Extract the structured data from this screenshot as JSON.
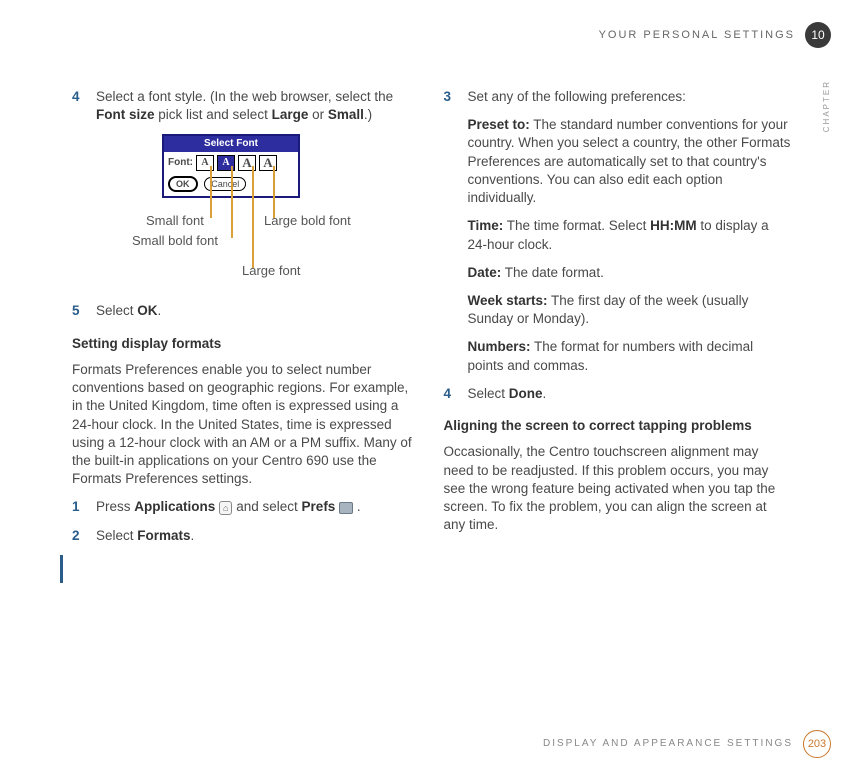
{
  "header": {
    "title": "YOUR PERSONAL SETTINGS",
    "chapter_num": "10"
  },
  "chapter_side": "CHAPTER",
  "footer": {
    "title": "DISPLAY AND APPEARANCE SETTINGS",
    "page_num": "203"
  },
  "left": {
    "step4": {
      "num": "4",
      "pre": "Select a font style. (In the web browser, select the ",
      "b1": "Font size",
      "mid": " pick list and select ",
      "b2": "Large",
      "or": " or ",
      "b3": "Small",
      "end": ".)"
    },
    "figure": {
      "title": "Select Font",
      "label": "Font:",
      "glyph": "A",
      "ok": "OK",
      "cancel": "Cancel",
      "callouts": {
        "small": "Small font",
        "smallbold": "Small bold font",
        "large": "Large font",
        "largebold": "Large bold font"
      }
    },
    "step5": {
      "num": "5",
      "pre": "Select ",
      "b": "OK",
      "end": "."
    },
    "subhead1": "Setting display formats",
    "para1": "Formats Preferences enable you to select number conventions based on geographic regions. For example, in the United Kingdom, time often is expressed using a 24-hour clock. In the United States, time is expressed using a 12-hour clock with an AM or a PM suffix. Many of the built-in applications on your Centro 690 use the Formats Preferences settings.",
    "step1": {
      "num": "1",
      "pre": "Press ",
      "b1": "Applications",
      "mid": " and select ",
      "b2": "Prefs",
      "end": " ."
    },
    "step2": {
      "num": "2",
      "pre": "Select ",
      "b": "Formats",
      "end": "."
    }
  },
  "right": {
    "step3": {
      "num": "3",
      "text": "Set any of the following preferences:"
    },
    "prefs": {
      "preset": {
        "label": "Preset to:",
        "text": " The standard number conventions for your country. When you select a country, the other Formats Preferences are automatically set to that country's conventions. You can also edit each option individually."
      },
      "time": {
        "label": "Time:",
        "pre": " The time format. Select ",
        "b": "HH:MM",
        "post": " to display a 24-hour clock."
      },
      "date": {
        "label": "Date:",
        "text": " The date format."
      },
      "week": {
        "label": "Week starts:",
        "text": " The first day of the week (usually Sunday or Monday)."
      },
      "numbers": {
        "label": "Numbers:",
        "text": " The format for numbers with decimal points and commas."
      }
    },
    "step4": {
      "num": "4",
      "pre": "Select ",
      "b": "Done",
      "end": "."
    },
    "subhead2": "Aligning the screen to correct tapping problems",
    "para2": "Occasionally, the Centro touchscreen alignment may need to be readjusted. If this problem occurs, you may see the wrong feature being activated when you tap the screen. To fix the problem, you can align the screen at any time."
  }
}
